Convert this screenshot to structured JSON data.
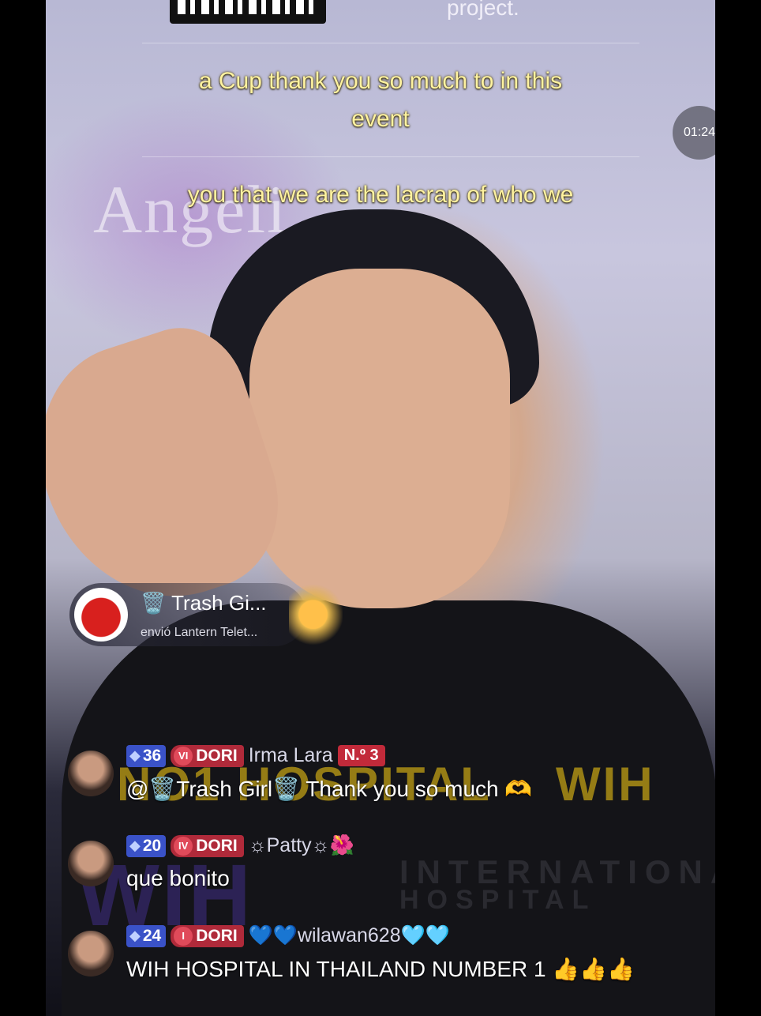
{
  "overlay": {
    "top_text": "project.",
    "captions": [
      "a Cup thank you so much to in this",
      "event",
      "you that we are the lacrap of who we"
    ],
    "timer": "01:24",
    "background_text": "Angeli"
  },
  "gift_banner": {
    "user": "🗑️ Trash Gi...",
    "action": "envió Lantern Telet...",
    "gift_icon": "lantern-teletubbies-gift-icon"
  },
  "watermark": {
    "line1": "NO1 HOSPITAL",
    "brand": "WIH",
    "international_line1": "INTERNATIONAL",
    "international_line2": "HOSPITAL"
  },
  "comments": [
    {
      "level": "36",
      "fan_tier": "VI",
      "fan_club": "DORI",
      "username": "Irma Lara",
      "rank": "N.º 3",
      "text": "@🗑️Trash Girl🗑️ Thank you so much 🫶"
    },
    {
      "level": "20",
      "fan_tier": "IV",
      "fan_club": "DORI",
      "username": "☼Patty☼🌺",
      "text": "que bonito"
    },
    {
      "level": "24",
      "fan_tier": "I",
      "fan_club": "DORI",
      "username": "💙💙wilawan628🩵🩵",
      "text": "WIH HOSPITAL IN THAILAND NUMBER 1 👍👍👍"
    }
  ],
  "colors": {
    "caption": "#fff3a0",
    "level_badge": "#3a52c8",
    "fan_badge": "#b02a3a"
  }
}
